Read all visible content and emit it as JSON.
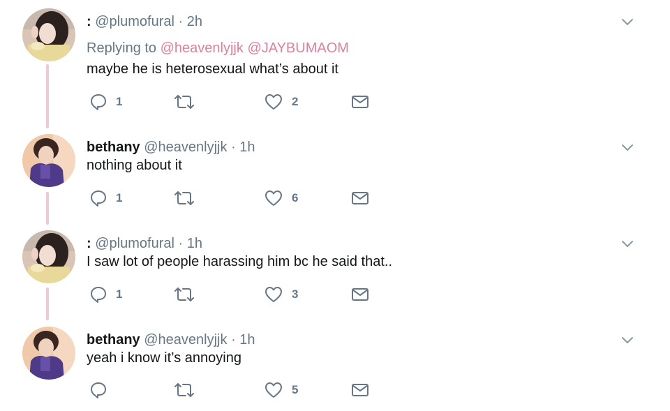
{
  "tweets": [
    {
      "name": ":",
      "handle": "@plumofural",
      "dot": "·",
      "time": "2h",
      "replying_prefix": "Replying to",
      "replying_to": [
        "@heavenlyjjk",
        "@JAYBUMAOM"
      ],
      "text": "maybe he is heterosexual what’s about it",
      "replies": "1",
      "likes": "2",
      "avatar": "pink-girl"
    },
    {
      "name": "bethany",
      "handle": "@heavenlyjjk",
      "dot": "·",
      "time": "1h",
      "text": "nothing about it",
      "replies": "1",
      "likes": "6",
      "avatar": "purple-boy"
    },
    {
      "name": ":",
      "handle": "@plumofural",
      "dot": "·",
      "time": "1h",
      "text": "I saw lot of people harassing him bc he said that..",
      "replies": "1",
      "likes": "3",
      "avatar": "pink-girl"
    },
    {
      "name": "bethany",
      "handle": "@heavenlyjjk",
      "dot": "·",
      "time": "1h",
      "text": "yeah i know it’s annoying",
      "replies": "",
      "likes": "5",
      "avatar": "purple-boy"
    }
  ],
  "icons": {
    "reply": "reply-icon",
    "retweet": "retweet-icon",
    "like": "heart-icon",
    "dm": "envelope-icon",
    "menu": "chevron-down-icon"
  },
  "colors": {
    "text": "#14171a",
    "secondary": "#657786",
    "mention": "#e0809c",
    "thread_line": "#f2c8d6"
  }
}
